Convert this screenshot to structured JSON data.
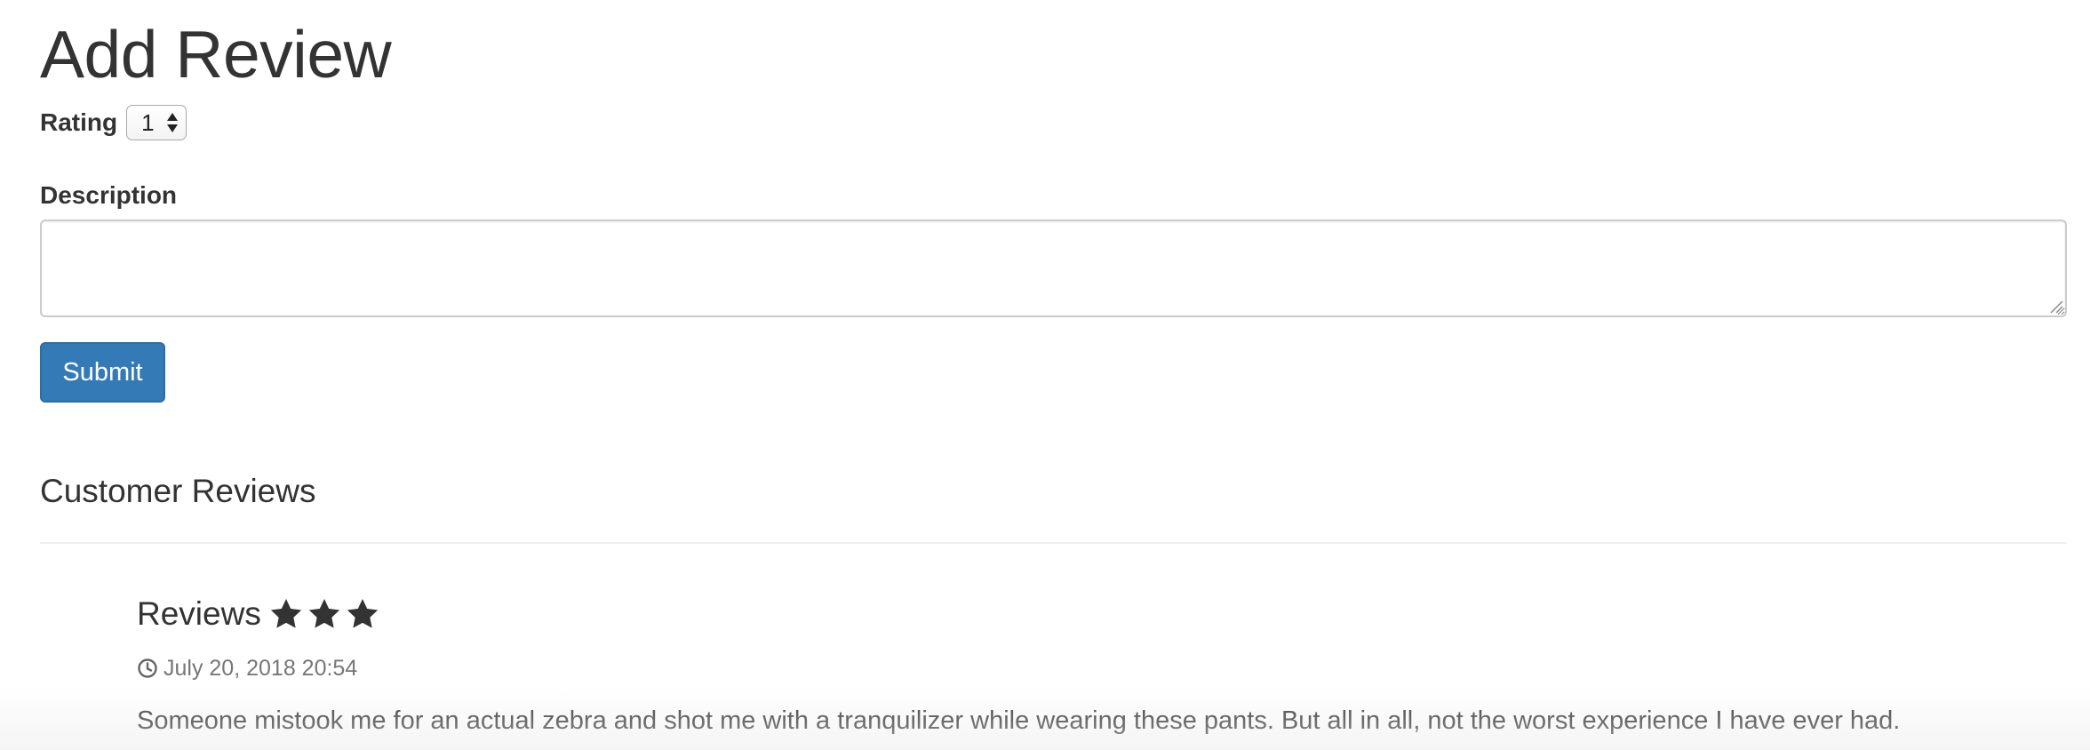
{
  "form": {
    "title": "Add Review",
    "rating_label": "Rating",
    "rating_value": "1",
    "description_label": "Description",
    "description_value": "",
    "submit_label": "Submit"
  },
  "reviews": {
    "heading": "Customer Reviews",
    "items": [
      {
        "title": "Reviews",
        "stars": 3,
        "date": "July 20, 2018 20:54",
        "text": "Someone mistook me for an actual zebra and shot me with a tranquilizer while wearing these pants. But all in all, not the worst experience I have ever had."
      }
    ]
  },
  "icons": {
    "star": "star-icon",
    "clock": "clock-icon",
    "stepper": "select-arrows-icon",
    "resize": "resize-handle-icon"
  },
  "colors": {
    "primary": "#337ab7",
    "text": "#333333",
    "muted": "#777777"
  }
}
